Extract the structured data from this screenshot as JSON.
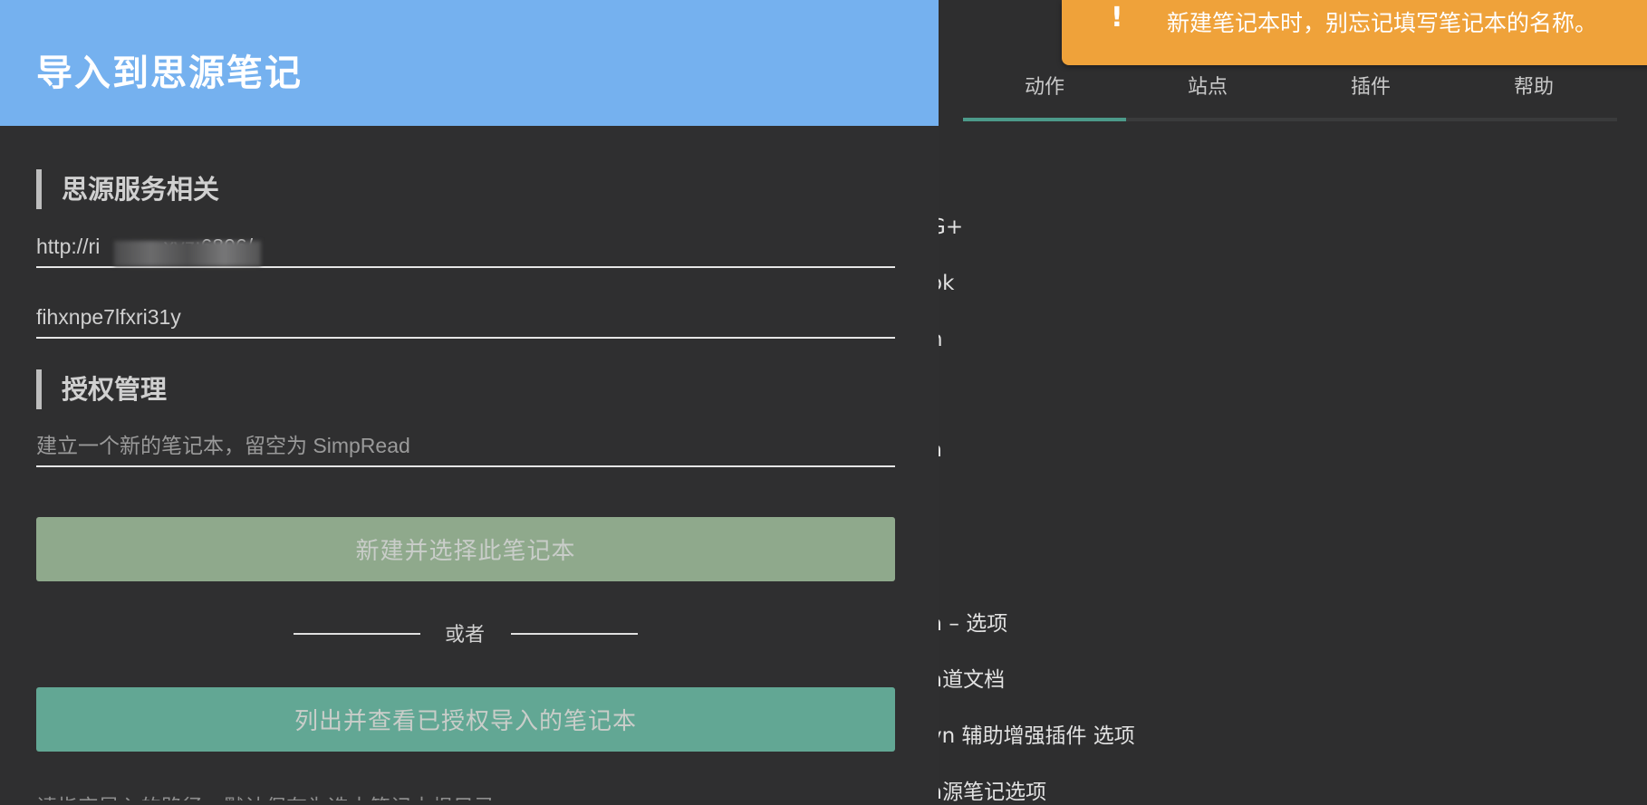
{
  "toast": {
    "icon": "exclamation-icon",
    "icon_glyph": "!",
    "message": "新建笔记本时，别忘记填写笔记本的名称。"
  },
  "background": {
    "tabs": [
      {
        "label": "动作",
        "active": true
      },
      {
        "label": "站点",
        "active": false
      },
      {
        "label": "插件",
        "active": false
      },
      {
        "label": "帮助",
        "active": false
      }
    ],
    "items": [
      {
        "label": "G+"
      },
      {
        "label": "ok"
      },
      {
        "label": "n"
      },
      {
        "label": "ā"
      },
      {
        "label": "ā – 选项"
      },
      {
        "label": "ā道文档"
      },
      {
        "label": "vn 辅助增强插件 选项"
      },
      {
        "label": "ā源笔记选项"
      }
    ]
  },
  "dialog": {
    "title": "导入到思源笔记",
    "section_service": "思源服务相关",
    "server_url": "http://ri          .xyz:6806/",
    "token": "fihxnpe7lfxri31y",
    "section_auth": "授权管理",
    "notebook_placeholder": "建立一个新的笔记本，留空为 SimpRead",
    "btn_new_notebook": "新建并选择此笔记本",
    "or_text": "或者",
    "btn_list_notebooks": "列出并查看已授权导入的笔记本",
    "hint": "请指定导入的路径，默认保存为选中笔记本根目录"
  },
  "colors": {
    "header": "#75b1ef",
    "toast": "#efa23a",
    "btn_new": "#8fa98c",
    "btn_list": "#62a794",
    "active_tab": "#4c9a8a"
  }
}
